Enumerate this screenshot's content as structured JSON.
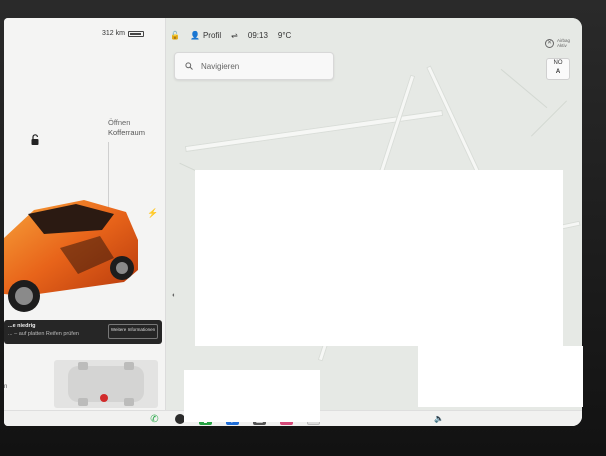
{
  "status": {
    "range": "312 km",
    "profile": "Profil",
    "time": "09:13",
    "temperature": "9°C"
  },
  "search": {
    "placeholder": "Navigieren"
  },
  "trunk": {
    "action": "Öffnen",
    "label": "Kofferraum"
  },
  "notice": {
    "title": "...e niedrig",
    "detail": "... – auf platten Reifen prüfen",
    "button": "Weitere Informationen"
  },
  "airbag": {
    "line1": "Airbag",
    "line2": "Aktiv"
  },
  "compass": {
    "heading": "NO",
    "letter": "A"
  },
  "tires": {
    "label": "n"
  },
  "colors": {
    "car": "#f07a1e",
    "map_bg": "#e6e9e5",
    "panel_bg": "#f4f4f3"
  },
  "dock": {
    "icons": [
      "phone-icon",
      "camera-icon",
      "energy-icon",
      "bluetooth-icon",
      "apps-icon",
      "media-icon",
      "calendar-icon"
    ]
  }
}
